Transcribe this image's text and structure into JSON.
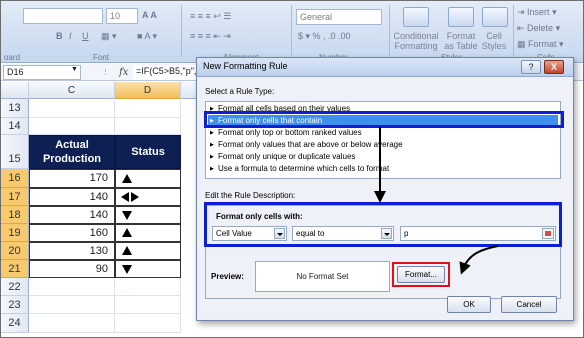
{
  "ribbon": {
    "font_name": "",
    "font_size": "10",
    "number_format": "General",
    "groups": {
      "clipboard": "oard",
      "font": "Font",
      "alignment": "Alignment",
      "number": "Number",
      "styles": "Styles",
      "cells": "Cells"
    },
    "buttons": {
      "bold": "B",
      "italic": "I",
      "underline": "U",
      "conditional_formatting": [
        "Conditional",
        "Formatting"
      ],
      "format_as_table": [
        "Format",
        "as Table"
      ],
      "cell_styles": [
        "Cell",
        "Styles"
      ],
      "insert": "Insert",
      "delete": "Delete",
      "format": "Format"
    }
  },
  "formula_bar": {
    "name_box": "D16",
    "fx": "fx",
    "formula": "=IF(C5>B5,\"p\",I"
  },
  "sheet": {
    "columns": [
      "C",
      "D"
    ],
    "rows": [
      "13",
      "14",
      "15",
      "16",
      "17",
      "18",
      "19",
      "20",
      "21",
      "22",
      "23",
      "24"
    ],
    "header_production": [
      "Actual",
      "Production"
    ],
    "header_status": "Status",
    "data": [
      {
        "value": "170",
        "status": "up"
      },
      {
        "value": "140",
        "status": "left-right"
      },
      {
        "value": "140",
        "status": "down"
      },
      {
        "value": "160",
        "status": "up"
      },
      {
        "value": "130",
        "status": "up"
      },
      {
        "value": "90",
        "status": "down"
      }
    ]
  },
  "dialog": {
    "title": "New Formatting Rule",
    "help": "?",
    "close": "X",
    "select_label": "Select a Rule Type:",
    "rule_types": [
      "Format all cells based on their values",
      "Format only cells that contain",
      "Format only top or bottom ranked values",
      "Format only values that are above or below average",
      "Format only unique or duplicate values",
      "Use a formula to determine which cells to format"
    ],
    "edit_label": "Edit the Rule Description:",
    "format_only_label": "Format only cells with:",
    "condition_type": "Cell Value",
    "operator": "equal to",
    "value": "p",
    "preview_label": "Preview:",
    "preview_text": "No Format Set",
    "format_button": "Format...",
    "ok_button": "OK",
    "cancel_button": "Cancel"
  },
  "colors": {
    "header_fill": "#0e1f54",
    "highlight_blue": "#0a1fd6",
    "highlight_red": "#e0101a",
    "selected_row": "#f7ca6e"
  }
}
